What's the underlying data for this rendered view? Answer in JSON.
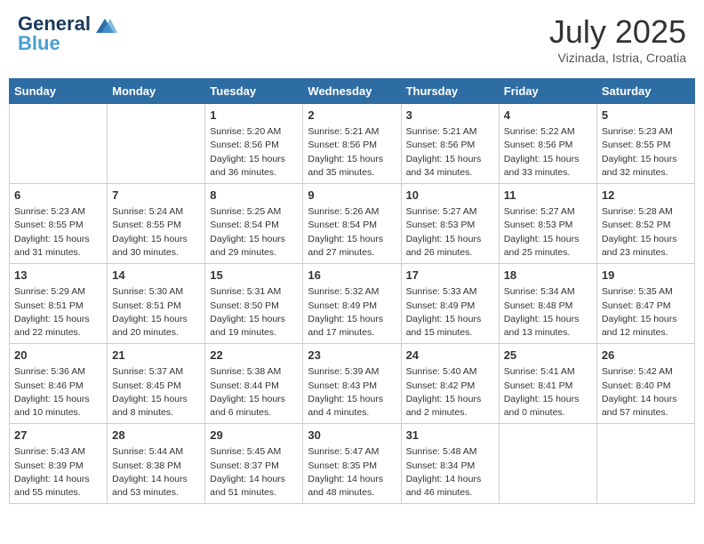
{
  "header": {
    "logo_line1": "General",
    "logo_line2": "Blue",
    "month": "July 2025",
    "location": "Vizinada, Istria, Croatia"
  },
  "days_of_week": [
    "Sunday",
    "Monday",
    "Tuesday",
    "Wednesday",
    "Thursday",
    "Friday",
    "Saturday"
  ],
  "weeks": [
    [
      {
        "day": "",
        "sunrise": "",
        "sunset": "",
        "daylight": ""
      },
      {
        "day": "",
        "sunrise": "",
        "sunset": "",
        "daylight": ""
      },
      {
        "day": "1",
        "sunrise": "Sunrise: 5:20 AM",
        "sunset": "Sunset: 8:56 PM",
        "daylight": "Daylight: 15 hours and 36 minutes."
      },
      {
        "day": "2",
        "sunrise": "Sunrise: 5:21 AM",
        "sunset": "Sunset: 8:56 PM",
        "daylight": "Daylight: 15 hours and 35 minutes."
      },
      {
        "day": "3",
        "sunrise": "Sunrise: 5:21 AM",
        "sunset": "Sunset: 8:56 PM",
        "daylight": "Daylight: 15 hours and 34 minutes."
      },
      {
        "day": "4",
        "sunrise": "Sunrise: 5:22 AM",
        "sunset": "Sunset: 8:56 PM",
        "daylight": "Daylight: 15 hours and 33 minutes."
      },
      {
        "day": "5",
        "sunrise": "Sunrise: 5:23 AM",
        "sunset": "Sunset: 8:55 PM",
        "daylight": "Daylight: 15 hours and 32 minutes."
      }
    ],
    [
      {
        "day": "6",
        "sunrise": "Sunrise: 5:23 AM",
        "sunset": "Sunset: 8:55 PM",
        "daylight": "Daylight: 15 hours and 31 minutes."
      },
      {
        "day": "7",
        "sunrise": "Sunrise: 5:24 AM",
        "sunset": "Sunset: 8:55 PM",
        "daylight": "Daylight: 15 hours and 30 minutes."
      },
      {
        "day": "8",
        "sunrise": "Sunrise: 5:25 AM",
        "sunset": "Sunset: 8:54 PM",
        "daylight": "Daylight: 15 hours and 29 minutes."
      },
      {
        "day": "9",
        "sunrise": "Sunrise: 5:26 AM",
        "sunset": "Sunset: 8:54 PM",
        "daylight": "Daylight: 15 hours and 27 minutes."
      },
      {
        "day": "10",
        "sunrise": "Sunrise: 5:27 AM",
        "sunset": "Sunset: 8:53 PM",
        "daylight": "Daylight: 15 hours and 26 minutes."
      },
      {
        "day": "11",
        "sunrise": "Sunrise: 5:27 AM",
        "sunset": "Sunset: 8:53 PM",
        "daylight": "Daylight: 15 hours and 25 minutes."
      },
      {
        "day": "12",
        "sunrise": "Sunrise: 5:28 AM",
        "sunset": "Sunset: 8:52 PM",
        "daylight": "Daylight: 15 hours and 23 minutes."
      }
    ],
    [
      {
        "day": "13",
        "sunrise": "Sunrise: 5:29 AM",
        "sunset": "Sunset: 8:51 PM",
        "daylight": "Daylight: 15 hours and 22 minutes."
      },
      {
        "day": "14",
        "sunrise": "Sunrise: 5:30 AM",
        "sunset": "Sunset: 8:51 PM",
        "daylight": "Daylight: 15 hours and 20 minutes."
      },
      {
        "day": "15",
        "sunrise": "Sunrise: 5:31 AM",
        "sunset": "Sunset: 8:50 PM",
        "daylight": "Daylight: 15 hours and 19 minutes."
      },
      {
        "day": "16",
        "sunrise": "Sunrise: 5:32 AM",
        "sunset": "Sunset: 8:49 PM",
        "daylight": "Daylight: 15 hours and 17 minutes."
      },
      {
        "day": "17",
        "sunrise": "Sunrise: 5:33 AM",
        "sunset": "Sunset: 8:49 PM",
        "daylight": "Daylight: 15 hours and 15 minutes."
      },
      {
        "day": "18",
        "sunrise": "Sunrise: 5:34 AM",
        "sunset": "Sunset: 8:48 PM",
        "daylight": "Daylight: 15 hours and 13 minutes."
      },
      {
        "day": "19",
        "sunrise": "Sunrise: 5:35 AM",
        "sunset": "Sunset: 8:47 PM",
        "daylight": "Daylight: 15 hours and 12 minutes."
      }
    ],
    [
      {
        "day": "20",
        "sunrise": "Sunrise: 5:36 AM",
        "sunset": "Sunset: 8:46 PM",
        "daylight": "Daylight: 15 hours and 10 minutes."
      },
      {
        "day": "21",
        "sunrise": "Sunrise: 5:37 AM",
        "sunset": "Sunset: 8:45 PM",
        "daylight": "Daylight: 15 hours and 8 minutes."
      },
      {
        "day": "22",
        "sunrise": "Sunrise: 5:38 AM",
        "sunset": "Sunset: 8:44 PM",
        "daylight": "Daylight: 15 hours and 6 minutes."
      },
      {
        "day": "23",
        "sunrise": "Sunrise: 5:39 AM",
        "sunset": "Sunset: 8:43 PM",
        "daylight": "Daylight: 15 hours and 4 minutes."
      },
      {
        "day": "24",
        "sunrise": "Sunrise: 5:40 AM",
        "sunset": "Sunset: 8:42 PM",
        "daylight": "Daylight: 15 hours and 2 minutes."
      },
      {
        "day": "25",
        "sunrise": "Sunrise: 5:41 AM",
        "sunset": "Sunset: 8:41 PM",
        "daylight": "Daylight: 15 hours and 0 minutes."
      },
      {
        "day": "26",
        "sunrise": "Sunrise: 5:42 AM",
        "sunset": "Sunset: 8:40 PM",
        "daylight": "Daylight: 14 hours and 57 minutes."
      }
    ],
    [
      {
        "day": "27",
        "sunrise": "Sunrise: 5:43 AM",
        "sunset": "Sunset: 8:39 PM",
        "daylight": "Daylight: 14 hours and 55 minutes."
      },
      {
        "day": "28",
        "sunrise": "Sunrise: 5:44 AM",
        "sunset": "Sunset: 8:38 PM",
        "daylight": "Daylight: 14 hours and 53 minutes."
      },
      {
        "day": "29",
        "sunrise": "Sunrise: 5:45 AM",
        "sunset": "Sunset: 8:37 PM",
        "daylight": "Daylight: 14 hours and 51 minutes."
      },
      {
        "day": "30",
        "sunrise": "Sunrise: 5:47 AM",
        "sunset": "Sunset: 8:35 PM",
        "daylight": "Daylight: 14 hours and 48 minutes."
      },
      {
        "day": "31",
        "sunrise": "Sunrise: 5:48 AM",
        "sunset": "Sunset: 8:34 PM",
        "daylight": "Daylight: 14 hours and 46 minutes."
      },
      {
        "day": "",
        "sunrise": "",
        "sunset": "",
        "daylight": ""
      },
      {
        "day": "",
        "sunrise": "",
        "sunset": "",
        "daylight": ""
      }
    ]
  ]
}
